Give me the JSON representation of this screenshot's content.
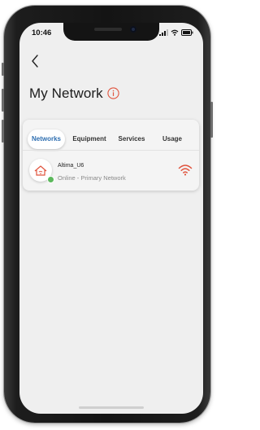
{
  "status_bar": {
    "time": "10:46"
  },
  "nav": {
    "back_icon": "chevron-left-icon"
  },
  "header": {
    "title": "My Network",
    "info_icon": "info-circle-icon",
    "accent_color": "#e0533d"
  },
  "tabs": [
    {
      "label": "Networks",
      "active": true
    },
    {
      "label": "Equipment",
      "active": false
    },
    {
      "label": "Services",
      "active": false
    },
    {
      "label": "Usage",
      "active": false
    }
  ],
  "networks": [
    {
      "name": "Altima_U6",
      "status": "Online - Primary Network",
      "icon": "home-wifi-icon",
      "status_color": "#5cb85c",
      "signal_icon": "wifi-icon"
    }
  ],
  "colors": {
    "active_tab": "#2f6fb1",
    "brand": "#e0533d"
  }
}
